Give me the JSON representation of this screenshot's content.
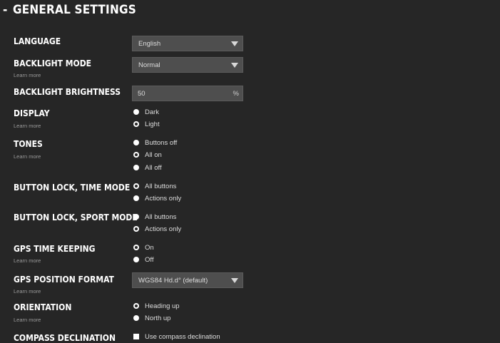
{
  "header": {
    "toggle": "-",
    "title": "GENERAL SETTINGS"
  },
  "learn_more": "Learn more",
  "settings": {
    "language": {
      "label": "LANGUAGE",
      "value": "English",
      "icon": "chevron-down-icon"
    },
    "backlight_mode": {
      "label": "BACKLIGHT MODE",
      "value": "Normal",
      "icon": "chevron-down-icon"
    },
    "backlight_brightness": {
      "label": "BACKLIGHT BRIGHTNESS",
      "value": "50",
      "unit": "%"
    },
    "display": {
      "label": "DISPLAY",
      "selected": "Light",
      "options": [
        "Dark",
        "Light"
      ]
    },
    "tones": {
      "label": "TONES",
      "selected": "All on",
      "options": [
        "Buttons off",
        "All on",
        "All off"
      ]
    },
    "button_lock_time": {
      "label": "BUTTON LOCK, TIME MODE",
      "selected": "All buttons",
      "options": [
        "All buttons",
        "Actions only"
      ]
    },
    "button_lock_sport": {
      "label": "BUTTON LOCK, SPORT MODE",
      "selected": "Actions only",
      "options": [
        "All buttons",
        "Actions only"
      ]
    },
    "gps_time_keeping": {
      "label": "GPS TIME KEEPING",
      "selected": "On",
      "options": [
        "On",
        "Off"
      ]
    },
    "gps_position_format": {
      "label": "GPS POSITION FORMAT",
      "value": "WGS84 Hd.d° (default)",
      "icon": "chevron-down-icon"
    },
    "orientation": {
      "label": "ORIENTATION",
      "selected": "Heading up",
      "options": [
        "Heading up",
        "North up"
      ]
    },
    "compass_declination": {
      "label": "COMPASS DECLINATION",
      "checkbox_label": "Use compass declination",
      "checked": false
    }
  },
  "colors": {
    "background": "#262626",
    "field": "#4e4e4e",
    "text": "#ffffff",
    "muted": "#9a9a9a"
  }
}
